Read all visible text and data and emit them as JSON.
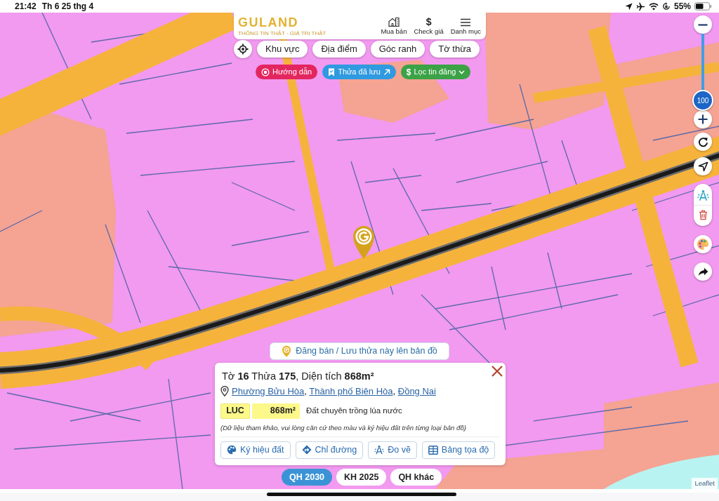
{
  "device_status_bar": {
    "time": "21:42",
    "date": "Th 6 25 thg 4",
    "battery": "55%"
  },
  "header": {
    "logo": "GULAND",
    "tagline": "THÔNG TIN THẬT · GIÁ TRỊ THẬT",
    "nav": [
      {
        "kind": "building",
        "label": "Mua bán"
      },
      {
        "kind": "dollar",
        "glyph": "$",
        "label": "Check giá"
      },
      {
        "kind": "menu",
        "label": "Danh mục"
      }
    ]
  },
  "search_buttons": [
    {
      "label": "Khu vực"
    },
    {
      "label": "Địa điểm"
    },
    {
      "label": "Góc ranh"
    },
    {
      "label": "Tờ thừa"
    }
  ],
  "quick_buttons": [
    {
      "kind": "guide",
      "label": "Hướng dẫn"
    },
    {
      "kind": "saved",
      "label": "Thửa đã lưu"
    },
    {
      "kind": "filter",
      "glyph": "$",
      "label": "Lọc tin đăng"
    }
  ],
  "map_controls": {
    "zoom": {
      "value": "100",
      "level": 1
    },
    "tool_groups": [
      {
        "tools": [
          {
            "kind": "refresh"
          }
        ]
      },
      {
        "tools": [
          {
            "kind": "navigate"
          }
        ]
      },
      {
        "tools": [
          {
            "kind": "measure"
          },
          {
            "kind": "delete"
          }
        ]
      },
      {
        "tools": [
          {
            "kind": "palette"
          }
        ]
      },
      {
        "tools": [
          {
            "kind": "share"
          }
        ]
      }
    ]
  },
  "publish_button": {
    "label": "Đăng bán / Lưu thửa này lên bản đồ"
  },
  "parcel_popup": {
    "title": "Tờ **16** Thửa **175**, Diện tích **868m²**",
    "address": [
      {
        "kind": "link",
        "text": "Phường Bửu Hòa"
      },
      {
        "kind": "text",
        "text": ", "
      },
      {
        "kind": "link",
        "text": "Thành phố Biên Hòa"
      },
      {
        "kind": "text",
        "text": ", "
      },
      {
        "kind": "link",
        "text": "Đồng Nai"
      }
    ],
    "land_use": {
      "code": "LUC",
      "area": "868m²",
      "description": "Đất chuyên trồng lúa nước"
    },
    "note": "(Dữ liệu tham khảo, vui lòng căn cứ theo màu và ký hiệu đất trên từng loại bản đồ)",
    "actions": [
      {
        "kind": "palette",
        "label": "Ký hiệu đất"
      },
      {
        "kind": "directions",
        "label": "Chỉ đường"
      },
      {
        "kind": "measure",
        "label": "Đo vẽ"
      },
      {
        "kind": "table",
        "label": "Bảng tọa độ"
      }
    ]
  },
  "map_layers": [
    {
      "label": "QH 2030",
      "selected": true
    },
    {
      "label": "KH 2025",
      "selected": false
    },
    {
      "label": "QH khác",
      "selected": false
    }
  ],
  "attribution": "Leaflet"
}
